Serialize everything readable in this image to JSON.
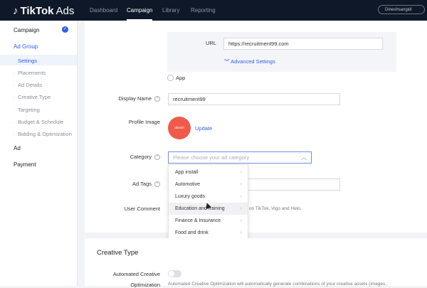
{
  "topbar": {
    "logo_name": "TikTok",
    "logo_suffix": "Ads",
    "nav": [
      "Dashboard",
      "Campaign",
      "Library",
      "Reporting"
    ],
    "active_nav": "Campaign",
    "account": "Dineshsangidi"
  },
  "sidebar": {
    "campaign": "Campaign",
    "ad_group": "Ad Group",
    "items": [
      "Settings",
      "Placements",
      "Ad Details",
      "Creative Type",
      "Targeting",
      "Budget & Schedule",
      "Bidding & Optimization"
    ],
    "ad": "Ad",
    "payment": "Payment"
  },
  "form": {
    "url_label": "URL",
    "url_value": "https://recruitment99.com",
    "advanced_settings": "Advanced Settings",
    "app_option": "App",
    "display_name_label": "Display Name",
    "display_name_value": "recruitment99",
    "profile_image_label": "Profile Image",
    "profile_image_text": "dinesh",
    "update_link": "Update",
    "category_label": "Category",
    "category_placeholder": "Please choose your ad category",
    "ad_tags_label": "Ad Tags",
    "user_comment_label": "User Comment",
    "user_comment_hint": "on TikTok, Vigo and Helo."
  },
  "category_options": [
    "App install",
    "Automotive",
    "Luxury goods",
    "Education and training",
    "Finance & Insurance",
    "Food and drink"
  ],
  "creative": {
    "title": "Creative Type",
    "automated_label": "Automated Creative",
    "optimization_label": "Optimization",
    "automated_desc": "Automated Creative Optimization will automatically generate combinations of your creative assets (images,"
  },
  "colors": {
    "topbar": "#0e1828",
    "accent": "#2d5fe6",
    "avatar": "#f05a4b"
  }
}
